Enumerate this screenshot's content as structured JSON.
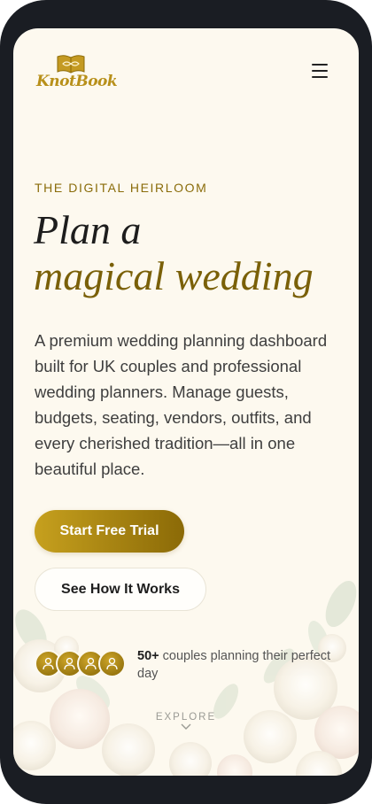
{
  "brand": {
    "name": "KnotBook"
  },
  "header": {
    "menu_icon": "hamburger-menu-icon"
  },
  "hero": {
    "eyebrow": "THE DIGITAL HEIRLOOM",
    "headline_line1": "Plan a",
    "headline_line2": "magical wedding",
    "description": "A premium wedding planning dashboard built for UK couples and professional wedding planners. Manage guests, budgets, seating, vendors, outfits, and every cherished tradition—all in one beautiful place.",
    "primary_cta": "Start Free Trial",
    "secondary_cta": "See How It Works"
  },
  "social_proof": {
    "count": "50+",
    "text": "couples planning their perfect day",
    "avatar_icon": "user-icon"
  },
  "scroll_hint": {
    "label": "EXPLORE",
    "icon": "chevron-down-icon"
  },
  "colors": {
    "background": "#fdf9ef",
    "gold": "#b8901a",
    "gold_dark": "#7a6008",
    "text": "#1d1d1d",
    "device_frame": "#1a1d23"
  }
}
